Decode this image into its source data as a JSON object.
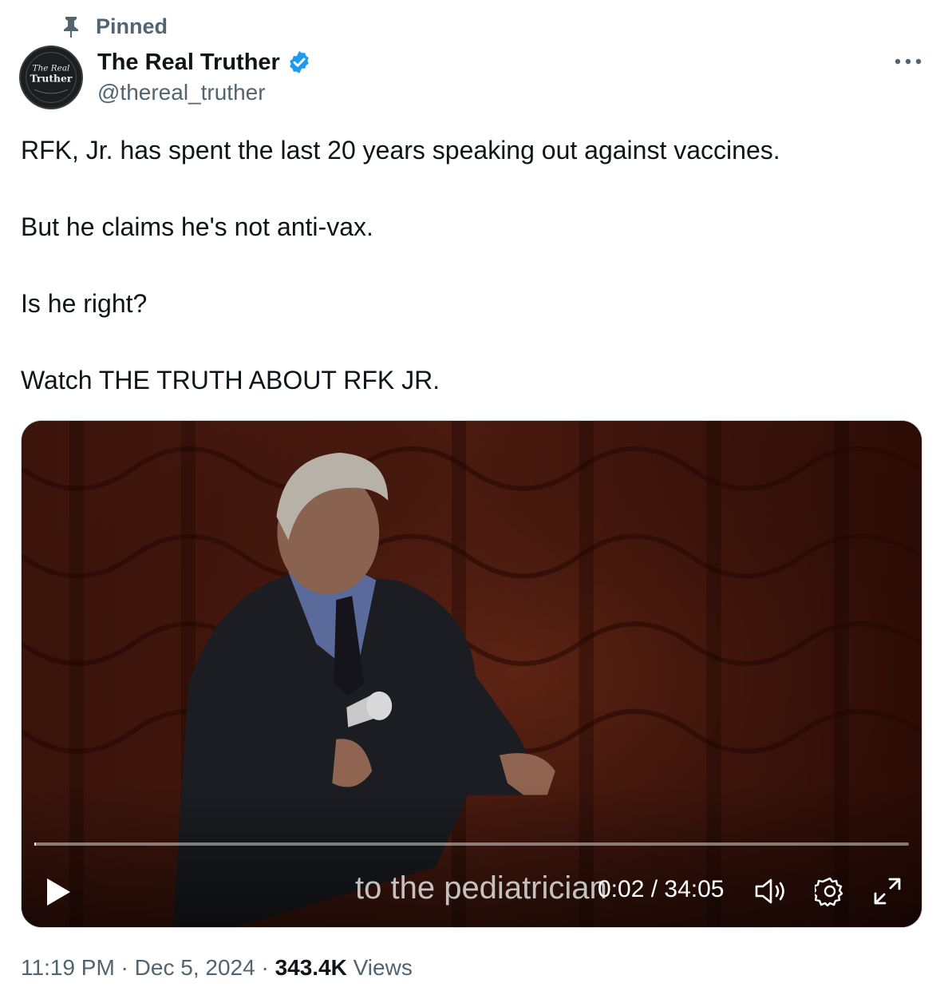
{
  "pinned": {
    "label": "Pinned"
  },
  "author": {
    "display_name": "The Real Truther",
    "handle": "@thereal_truther",
    "avatar_text_top": "The Real",
    "avatar_text_main": "Truther",
    "verified_color": "#1d9bf0"
  },
  "tweet": {
    "lines": [
      "RFK, Jr. has spent the last 20 years speaking out against vaccines.",
      "But he claims he's not anti-vax.",
      "Is he right?",
      "Watch THE TRUTH ABOUT RFK JR."
    ]
  },
  "video": {
    "caption": "to the pediatrician",
    "current_time": "0:02",
    "duration": "34:05",
    "time_text": "0:02 / 34:05",
    "progress_fraction": 0.001,
    "icons": [
      "play-icon",
      "volume-icon",
      "settings-icon",
      "fullscreen-icon"
    ]
  },
  "meta": {
    "time": "11:19 PM",
    "separator": " · ",
    "date": "Dec 5, 2024",
    "views_count": "343.4K",
    "views_label": "Views"
  },
  "icons": {
    "pin": "pin-icon",
    "more": "more-icon",
    "verified": "verified-badge-icon"
  },
  "colors": {
    "text_primary": "#0f1419",
    "text_secondary": "#536471",
    "accent": "#1d9bf0"
  }
}
